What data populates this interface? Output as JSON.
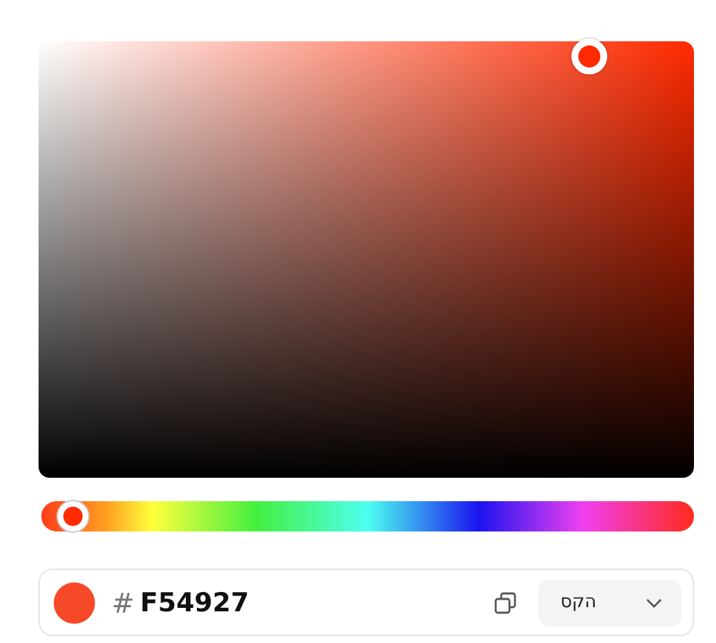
{
  "hue_slider": {
    "level": 0.0275
  },
  "color_field": {
    "hash": "#",
    "value": "F54927",
    "format": {
      "label": "הקס"
    }
  }
}
